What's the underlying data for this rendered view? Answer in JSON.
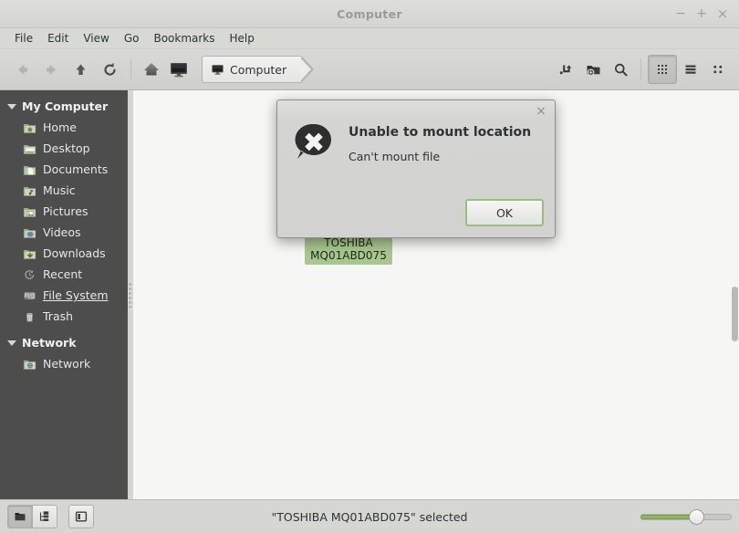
{
  "window": {
    "title": "Computer",
    "minimize": "−",
    "maximize": "+",
    "close": "×"
  },
  "menubar": {
    "items": [
      {
        "label": "File"
      },
      {
        "label": "Edit"
      },
      {
        "label": "View"
      },
      {
        "label": "Go"
      },
      {
        "label": "Bookmarks"
      },
      {
        "label": "Help"
      }
    ]
  },
  "toolbar": {
    "back": "back-icon",
    "forward": "forward-icon",
    "up": "up-icon",
    "reload": "reload-icon",
    "home": "home-icon",
    "computer": "computer-icon",
    "breadcrumb": "Computer",
    "open_terminal": "open-terminal-icon",
    "new_folder": "new-folder-icon",
    "search": "search-icon",
    "view_icon": "icon-view",
    "view_list": "list-view",
    "view_compact": "compact-view"
  },
  "sidebar": {
    "groups": [
      {
        "label": "My Computer",
        "items": [
          {
            "label": "Home",
            "icon": "folder-home-icon"
          },
          {
            "label": "Desktop",
            "icon": "folder-desktop-icon"
          },
          {
            "label": "Documents",
            "icon": "folder-documents-icon"
          },
          {
            "label": "Music",
            "icon": "folder-music-icon"
          },
          {
            "label": "Pictures",
            "icon": "folder-pictures-icon"
          },
          {
            "label": "Videos",
            "icon": "folder-videos-icon"
          },
          {
            "label": "Downloads",
            "icon": "folder-downloads-icon"
          },
          {
            "label": "Recent",
            "icon": "recent-icon"
          },
          {
            "label": "File System",
            "icon": "drive-harddisk-icon",
            "hovered": true
          },
          {
            "label": "Trash",
            "icon": "trash-icon"
          }
        ]
      },
      {
        "label": "Network",
        "items": [
          {
            "label": "Network",
            "icon": "network-icon"
          }
        ]
      }
    ]
  },
  "content": {
    "drive": {
      "icon": "drive-harddisk-icon",
      "label": "TOSHIBA\nMQ01ABD075",
      "selected": true
    }
  },
  "dialog": {
    "icon": "dialog-error-icon",
    "title": "Unable to mount location",
    "message": "Can't mount file",
    "ok_label": "OK",
    "close": "×"
  },
  "statusbar": {
    "buttons": [
      {
        "name": "show-places-button",
        "icon": "places-icon",
        "active": true
      },
      {
        "name": "show-tree-button",
        "icon": "tree-icon",
        "active": false
      },
      {
        "name": "toggle-sidebar-button",
        "icon": "sidebar-toggle-icon",
        "active": false
      }
    ],
    "status_text": "\"TOSHIBA MQ01ABD075\" selected",
    "zoom_percent": 60
  },
  "colors": {
    "sidebar_bg": "#4d4d4d",
    "content_bg": "#f6f6f5",
    "chrome_bg": "#d6d6d3",
    "selection_green": "#a8c68f",
    "accent_green": "#90b45f"
  }
}
